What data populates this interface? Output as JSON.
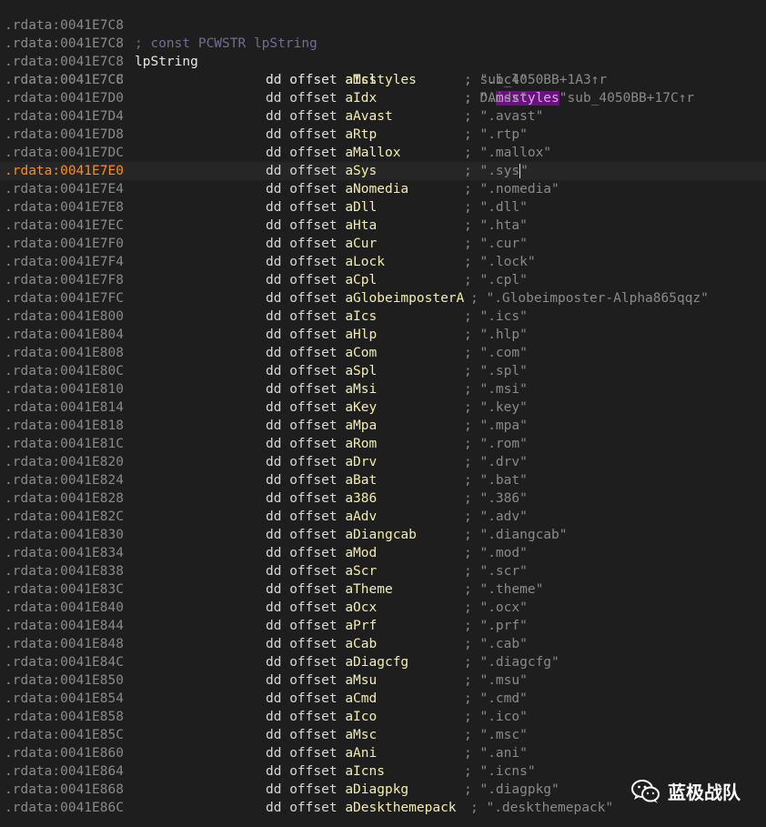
{
  "header": {
    "address": ".rdata:0041E7C8",
    "comment": "; const PCWSTR lpString"
  },
  "label_row": {
    "address": ".rdata:0041E7C8",
    "label": "lpString",
    "instruction": "dd offset",
    "operand": "aMsstyles",
    "comment": "; DATA XREF: sub_4050BB+17C↑r"
  },
  "xref_row": {
    "address": ".rdata:0041E7C8",
    "comment": "; sub_4050BB+1A3↑r"
  },
  "msstyles_row": {
    "address": ".rdata:0041E7C8",
    "comment_prefix": "; \".",
    "comment_highlight": "msstyles",
    "comment_suffix": "\""
  },
  "entries": [
    {
      "address": ".rdata:0041E7CC",
      "instruction": "dd offset",
      "operand": "aIcl",
      "comment": "; \".icl\""
    },
    {
      "address": ".rdata:0041E7D0",
      "instruction": "dd offset",
      "operand": "aIdx",
      "comment": "; \".idx\""
    },
    {
      "address": ".rdata:0041E7D4",
      "instruction": "dd offset",
      "operand": "aAvast",
      "comment": "; \".avast\""
    },
    {
      "address": ".rdata:0041E7D8",
      "instruction": "dd offset",
      "operand": "aRtp",
      "comment": "; \".rtp\""
    },
    {
      "address": ".rdata:0041E7DC",
      "instruction": "dd offset",
      "operand": "aMallox",
      "comment": "; \".mallox\""
    },
    {
      "address": ".rdata:0041E7E0",
      "instruction": "dd offset",
      "operand": "aSys",
      "comment": "; \".sys\"",
      "current": true
    },
    {
      "address": ".rdata:0041E7E4",
      "instruction": "dd offset",
      "operand": "aNomedia",
      "comment": "; \".nomedia\""
    },
    {
      "address": ".rdata:0041E7E8",
      "instruction": "dd offset",
      "operand": "aDll",
      "comment": "; \".dll\""
    },
    {
      "address": ".rdata:0041E7EC",
      "instruction": "dd offset",
      "operand": "aHta",
      "comment": "; \".hta\""
    },
    {
      "address": ".rdata:0041E7F0",
      "instruction": "dd offset",
      "operand": "aCur",
      "comment": "; \".cur\""
    },
    {
      "address": ".rdata:0041E7F4",
      "instruction": "dd offset",
      "operand": "aLock",
      "comment": "; \".lock\""
    },
    {
      "address": ".rdata:0041E7F8",
      "instruction": "dd offset",
      "operand": "aCpl",
      "comment": "; \".cpl\""
    },
    {
      "address": ".rdata:0041E7FC",
      "instruction": "dd offset",
      "operand": "aGlobeimposterA",
      "comment": "; \".Globeimposter-Alpha865qqz\"",
      "wide": true
    },
    {
      "address": ".rdata:0041E800",
      "instruction": "dd offset",
      "operand": "aIcs",
      "comment": "; \".ics\""
    },
    {
      "address": ".rdata:0041E804",
      "instruction": "dd offset",
      "operand": "aHlp",
      "comment": "; \".hlp\""
    },
    {
      "address": ".rdata:0041E808",
      "instruction": "dd offset",
      "operand": "aCom",
      "comment": "; \".com\""
    },
    {
      "address": ".rdata:0041E80C",
      "instruction": "dd offset",
      "operand": "aSpl",
      "comment": "; \".spl\""
    },
    {
      "address": ".rdata:0041E810",
      "instruction": "dd offset",
      "operand": "aMsi",
      "comment": "; \".msi\""
    },
    {
      "address": ".rdata:0041E814",
      "instruction": "dd offset",
      "operand": "aKey",
      "comment": "; \".key\""
    },
    {
      "address": ".rdata:0041E818",
      "instruction": "dd offset",
      "operand": "aMpa",
      "comment": "; \".mpa\""
    },
    {
      "address": ".rdata:0041E81C",
      "instruction": "dd offset",
      "operand": "aRom",
      "comment": "; \".rom\""
    },
    {
      "address": ".rdata:0041E820",
      "instruction": "dd offset",
      "operand": "aDrv",
      "comment": "; \".drv\""
    },
    {
      "address": ".rdata:0041E824",
      "instruction": "dd offset",
      "operand": "aBat",
      "comment": "; \".bat\""
    },
    {
      "address": ".rdata:0041E828",
      "instruction": "dd offset",
      "operand": "a386",
      "comment": "; \".386\""
    },
    {
      "address": ".rdata:0041E82C",
      "instruction": "dd offset",
      "operand": "aAdv",
      "comment": "; \".adv\""
    },
    {
      "address": ".rdata:0041E830",
      "instruction": "dd offset",
      "operand": "aDiangcab",
      "comment": "; \".diangcab\""
    },
    {
      "address": ".rdata:0041E834",
      "instruction": "dd offset",
      "operand": "aMod",
      "comment": "; \".mod\""
    },
    {
      "address": ".rdata:0041E838",
      "instruction": "dd offset",
      "operand": "aScr",
      "comment": "; \".scr\""
    },
    {
      "address": ".rdata:0041E83C",
      "instruction": "dd offset",
      "operand": "aTheme",
      "comment": "; \".theme\""
    },
    {
      "address": ".rdata:0041E840",
      "instruction": "dd offset",
      "operand": "aOcx",
      "comment": "; \".ocx\""
    },
    {
      "address": ".rdata:0041E844",
      "instruction": "dd offset",
      "operand": "aPrf",
      "comment": "; \".prf\""
    },
    {
      "address": ".rdata:0041E848",
      "instruction": "dd offset",
      "operand": "aCab",
      "comment": "; \".cab\""
    },
    {
      "address": ".rdata:0041E84C",
      "instruction": "dd offset",
      "operand": "aDiagcfg",
      "comment": "; \".diagcfg\""
    },
    {
      "address": ".rdata:0041E850",
      "instruction": "dd offset",
      "operand": "aMsu",
      "comment": "; \".msu\""
    },
    {
      "address": ".rdata:0041E854",
      "instruction": "dd offset",
      "operand": "aCmd",
      "comment": "; \".cmd\""
    },
    {
      "address": ".rdata:0041E858",
      "instruction": "dd offset",
      "operand": "aIco",
      "comment": "; \".ico\""
    },
    {
      "address": ".rdata:0041E85C",
      "instruction": "dd offset",
      "operand": "aMsc",
      "comment": "; \".msc\""
    },
    {
      "address": ".rdata:0041E860",
      "instruction": "dd offset",
      "operand": "aAni",
      "comment": "; \".ani\""
    },
    {
      "address": ".rdata:0041E864",
      "instruction": "dd offset",
      "operand": "aIcns",
      "comment": "; \".icns\""
    },
    {
      "address": ".rdata:0041E868",
      "instruction": "dd offset",
      "operand": "aDiagpkg",
      "comment": "; \".diagpkg\""
    },
    {
      "address": ".rdata:0041E86C",
      "instruction": "dd offset",
      "operand": "aDeskthemepack",
      "comment": "; \".deskthemepack\"",
      "wide": true
    }
  ],
  "watermark": {
    "icon": "wechat-icon",
    "text": "蓝极战队"
  },
  "colors": {
    "background": "#1e1e1e",
    "address": "#8a8a8a",
    "current_address": "#ff8c1a",
    "operand": "#f2eeb0",
    "comment": "#8a8a8a",
    "highlight": "#6a137f"
  }
}
